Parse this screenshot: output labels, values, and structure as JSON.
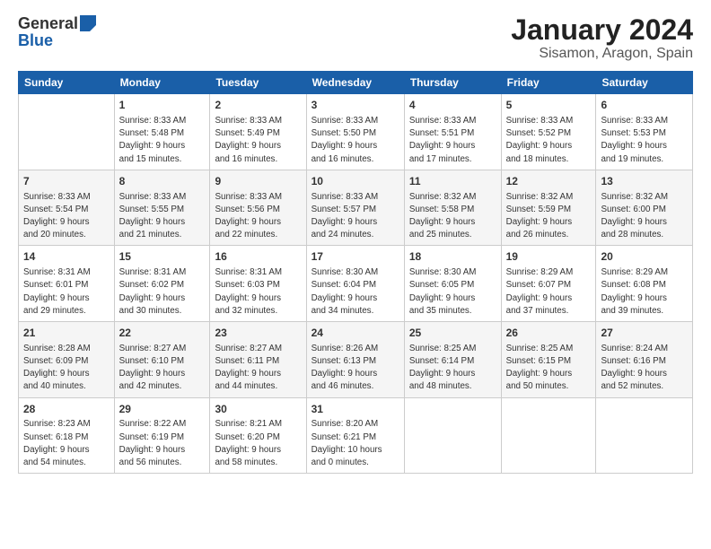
{
  "logo": {
    "general": "General",
    "blue": "Blue"
  },
  "title": {
    "month": "January 2024",
    "location": "Sisamon, Aragon, Spain"
  },
  "headers": [
    "Sunday",
    "Monday",
    "Tuesday",
    "Wednesday",
    "Thursday",
    "Friday",
    "Saturday"
  ],
  "weeks": [
    [
      {
        "day": "",
        "content": ""
      },
      {
        "day": "1",
        "content": "Sunrise: 8:33 AM\nSunset: 5:48 PM\nDaylight: 9 hours\nand 15 minutes."
      },
      {
        "day": "2",
        "content": "Sunrise: 8:33 AM\nSunset: 5:49 PM\nDaylight: 9 hours\nand 16 minutes."
      },
      {
        "day": "3",
        "content": "Sunrise: 8:33 AM\nSunset: 5:50 PM\nDaylight: 9 hours\nand 16 minutes."
      },
      {
        "day": "4",
        "content": "Sunrise: 8:33 AM\nSunset: 5:51 PM\nDaylight: 9 hours\nand 17 minutes."
      },
      {
        "day": "5",
        "content": "Sunrise: 8:33 AM\nSunset: 5:52 PM\nDaylight: 9 hours\nand 18 minutes."
      },
      {
        "day": "6",
        "content": "Sunrise: 8:33 AM\nSunset: 5:53 PM\nDaylight: 9 hours\nand 19 minutes."
      }
    ],
    [
      {
        "day": "7",
        "content": "Sunrise: 8:33 AM\nSunset: 5:54 PM\nDaylight: 9 hours\nand 20 minutes."
      },
      {
        "day": "8",
        "content": "Sunrise: 8:33 AM\nSunset: 5:55 PM\nDaylight: 9 hours\nand 21 minutes."
      },
      {
        "day": "9",
        "content": "Sunrise: 8:33 AM\nSunset: 5:56 PM\nDaylight: 9 hours\nand 22 minutes."
      },
      {
        "day": "10",
        "content": "Sunrise: 8:33 AM\nSunset: 5:57 PM\nDaylight: 9 hours\nand 24 minutes."
      },
      {
        "day": "11",
        "content": "Sunrise: 8:32 AM\nSunset: 5:58 PM\nDaylight: 9 hours\nand 25 minutes."
      },
      {
        "day": "12",
        "content": "Sunrise: 8:32 AM\nSunset: 5:59 PM\nDaylight: 9 hours\nand 26 minutes."
      },
      {
        "day": "13",
        "content": "Sunrise: 8:32 AM\nSunset: 6:00 PM\nDaylight: 9 hours\nand 28 minutes."
      }
    ],
    [
      {
        "day": "14",
        "content": "Sunrise: 8:31 AM\nSunset: 6:01 PM\nDaylight: 9 hours\nand 29 minutes."
      },
      {
        "day": "15",
        "content": "Sunrise: 8:31 AM\nSunset: 6:02 PM\nDaylight: 9 hours\nand 30 minutes."
      },
      {
        "day": "16",
        "content": "Sunrise: 8:31 AM\nSunset: 6:03 PM\nDaylight: 9 hours\nand 32 minutes."
      },
      {
        "day": "17",
        "content": "Sunrise: 8:30 AM\nSunset: 6:04 PM\nDaylight: 9 hours\nand 34 minutes."
      },
      {
        "day": "18",
        "content": "Sunrise: 8:30 AM\nSunset: 6:05 PM\nDaylight: 9 hours\nand 35 minutes."
      },
      {
        "day": "19",
        "content": "Sunrise: 8:29 AM\nSunset: 6:07 PM\nDaylight: 9 hours\nand 37 minutes."
      },
      {
        "day": "20",
        "content": "Sunrise: 8:29 AM\nSunset: 6:08 PM\nDaylight: 9 hours\nand 39 minutes."
      }
    ],
    [
      {
        "day": "21",
        "content": "Sunrise: 8:28 AM\nSunset: 6:09 PM\nDaylight: 9 hours\nand 40 minutes."
      },
      {
        "day": "22",
        "content": "Sunrise: 8:27 AM\nSunset: 6:10 PM\nDaylight: 9 hours\nand 42 minutes."
      },
      {
        "day": "23",
        "content": "Sunrise: 8:27 AM\nSunset: 6:11 PM\nDaylight: 9 hours\nand 44 minutes."
      },
      {
        "day": "24",
        "content": "Sunrise: 8:26 AM\nSunset: 6:13 PM\nDaylight: 9 hours\nand 46 minutes."
      },
      {
        "day": "25",
        "content": "Sunrise: 8:25 AM\nSunset: 6:14 PM\nDaylight: 9 hours\nand 48 minutes."
      },
      {
        "day": "26",
        "content": "Sunrise: 8:25 AM\nSunset: 6:15 PM\nDaylight: 9 hours\nand 50 minutes."
      },
      {
        "day": "27",
        "content": "Sunrise: 8:24 AM\nSunset: 6:16 PM\nDaylight: 9 hours\nand 52 minutes."
      }
    ],
    [
      {
        "day": "28",
        "content": "Sunrise: 8:23 AM\nSunset: 6:18 PM\nDaylight: 9 hours\nand 54 minutes."
      },
      {
        "day": "29",
        "content": "Sunrise: 8:22 AM\nSunset: 6:19 PM\nDaylight: 9 hours\nand 56 minutes."
      },
      {
        "day": "30",
        "content": "Sunrise: 8:21 AM\nSunset: 6:20 PM\nDaylight: 9 hours\nand 58 minutes."
      },
      {
        "day": "31",
        "content": "Sunrise: 8:20 AM\nSunset: 6:21 PM\nDaylight: 10 hours\nand 0 minutes."
      },
      {
        "day": "",
        "content": ""
      },
      {
        "day": "",
        "content": ""
      },
      {
        "day": "",
        "content": ""
      }
    ]
  ]
}
